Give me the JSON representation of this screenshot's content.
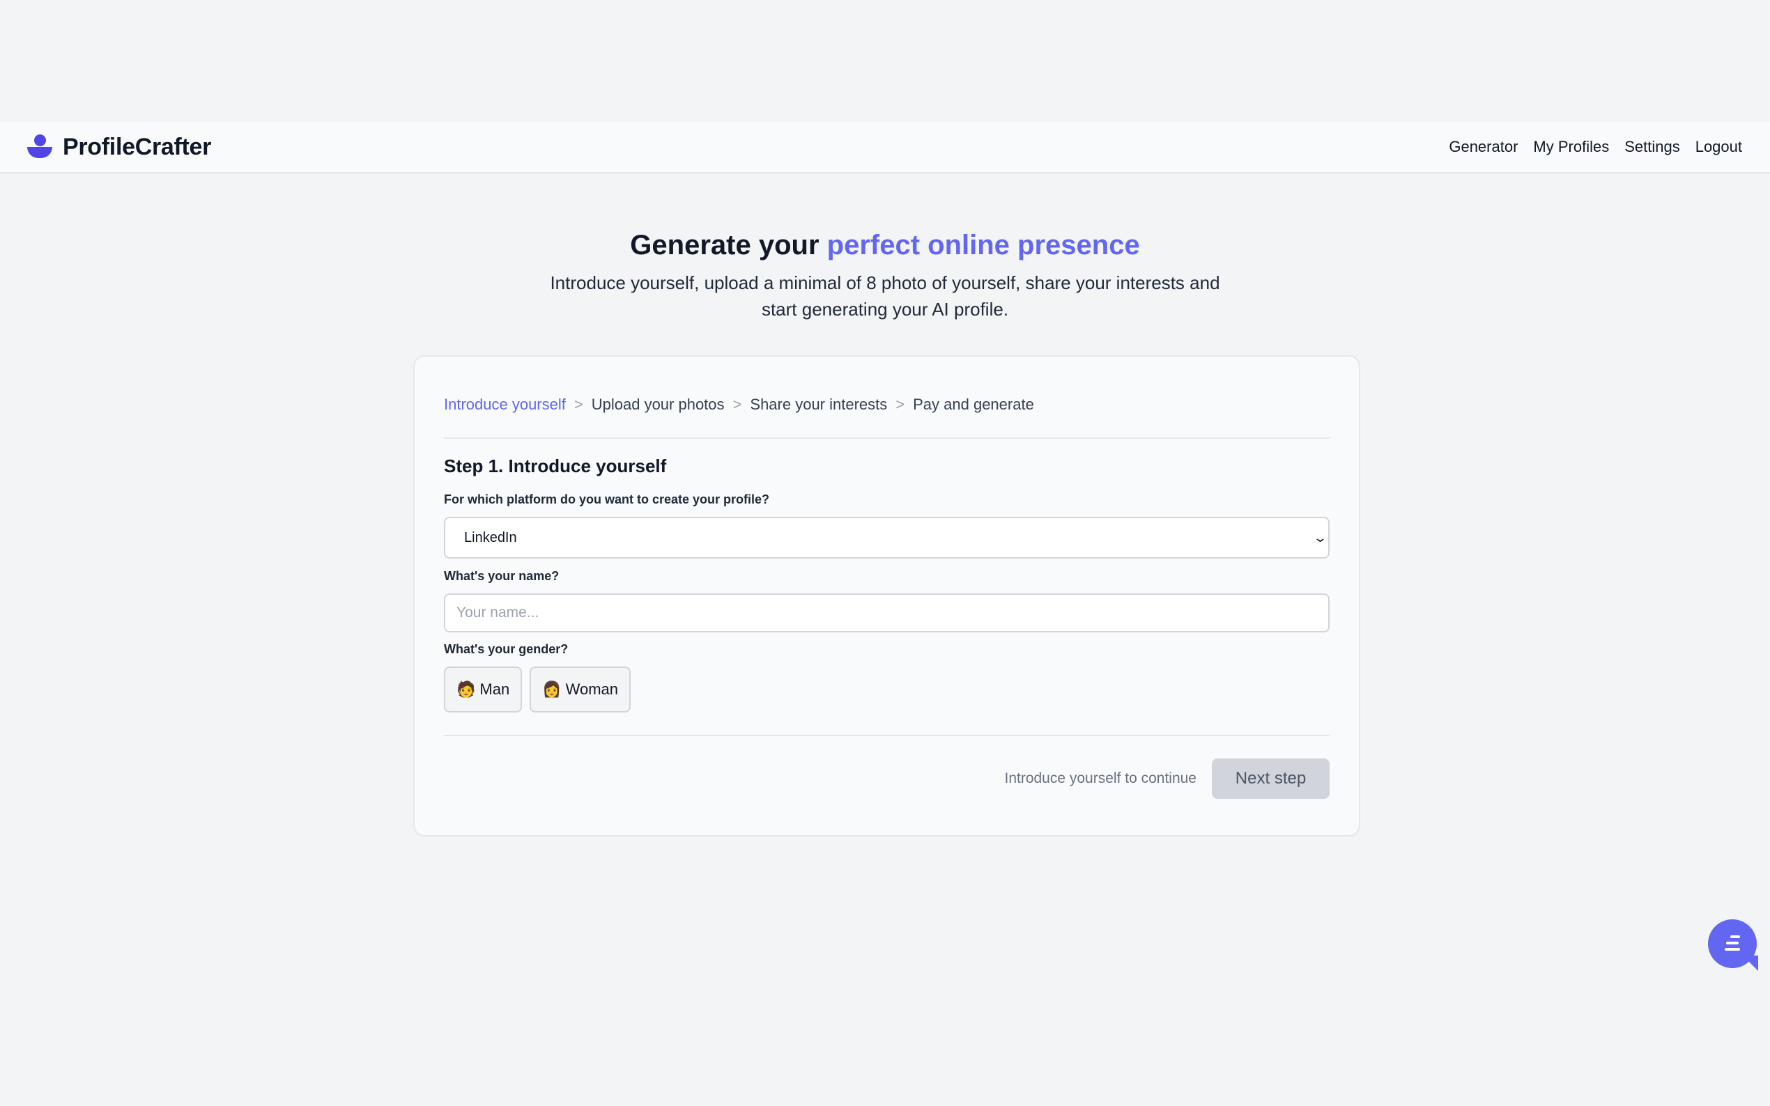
{
  "brand": {
    "name": "ProfileCrafter",
    "logo_icon": "person-icon",
    "color": "#4f46e5"
  },
  "nav": {
    "links": [
      "Generator",
      "My Profiles",
      "Settings",
      "Logout"
    ]
  },
  "hero": {
    "title_prefix": "Generate your",
    "title_accent": "perfect online presence",
    "subtitle": "Introduce yourself, upload a minimal of 8 photo of yourself, share your interests and start generating your AI profile."
  },
  "steps": {
    "items": [
      "Introduce yourself",
      "Upload your photos",
      "Share your interests",
      "Pay and generate"
    ],
    "active": "Introduce yourself",
    "separator": ">"
  },
  "form": {
    "title": "Step 1. Introduce yourself",
    "platform_label": "For which platform do you want to create your profile?",
    "platform_value": "LinkedIn",
    "name_label": "What's your name?",
    "name_placeholder": "Your name...",
    "name_value": "",
    "gender_label": "What's your gender?",
    "gender_options": [
      {
        "emoji": "🧑",
        "label": "Man"
      },
      {
        "emoji": "👩",
        "label": "Woman"
      }
    ]
  },
  "footer": {
    "hint": "Introduce yourself to continue",
    "next_label": "Next step"
  },
  "chat": {
    "icon": "chat-icon"
  },
  "colors": {
    "accent": "#6366f1",
    "background": "#f3f4f6",
    "button_disabled": "#d1d5db"
  }
}
